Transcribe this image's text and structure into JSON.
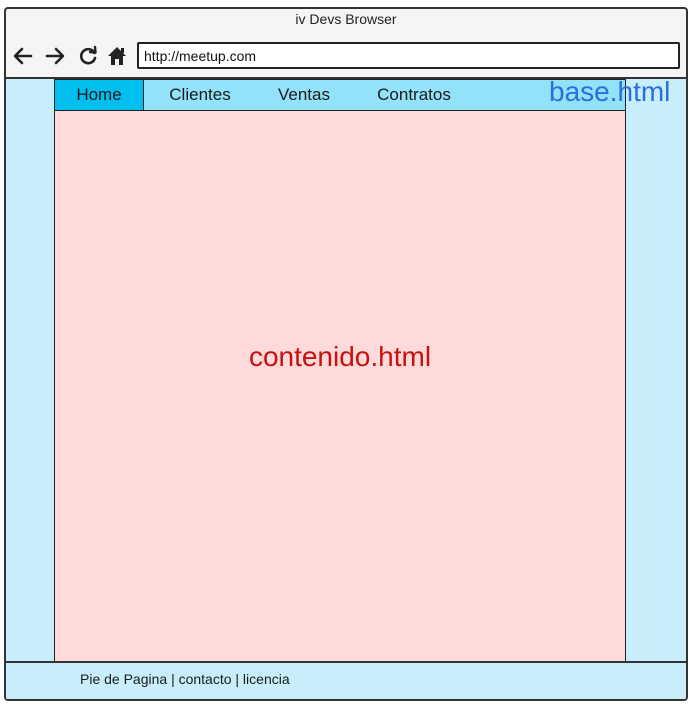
{
  "window": {
    "title": "iv Devs Browser"
  },
  "toolbar": {
    "back_icon": "arrow-left-icon",
    "forward_icon": "arrow-right-icon",
    "reload_icon": "reload-icon",
    "home_icon": "home-icon",
    "url": "http://meetup.com"
  },
  "menu": {
    "items": [
      {
        "label": "Home",
        "active": true
      },
      {
        "label": "Clientes",
        "active": false
      },
      {
        "label": "Ventas",
        "active": false
      },
      {
        "label": "Contratos",
        "active": false
      }
    ]
  },
  "labels": {
    "base": "base.html",
    "content": "contenido.html"
  },
  "footer": {
    "text": "Pie de Pagina | contacto | licencia"
  },
  "colors": {
    "menu_bg": "#92e2fa",
    "menu_active": "#00bfef",
    "content_bg": "#ffdada",
    "page_bg": "#c8eefc",
    "base_label": "#2b6fe0",
    "content_label": "#c81010"
  }
}
